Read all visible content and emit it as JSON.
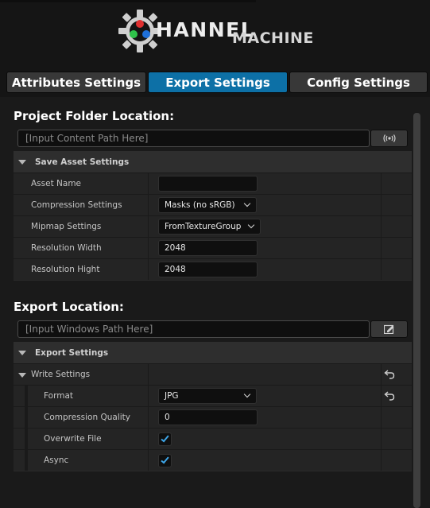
{
  "logo": {
    "first_word": "HANNEL",
    "second_word": "MACHINE",
    "icon": "gear-rgb-icon",
    "colors": {
      "red": "#e03030",
      "green": "#2fc34a",
      "blue": "#1e6fd9",
      "gear": "#cfcfcf"
    }
  },
  "tabs": [
    {
      "label": "Attributes Settings",
      "active": false
    },
    {
      "label": "Export Settings",
      "active": true
    },
    {
      "label": "Config Settings",
      "active": false
    }
  ],
  "accent_color": "#0d70a6",
  "project_folder": {
    "title": "Project Folder Location:",
    "placeholder": "[Input Content Path Here]",
    "button_icon": "broadcast-icon"
  },
  "save_asset": {
    "category_label": "Save Asset Settings",
    "rows": [
      {
        "label": "Asset Name",
        "value": ""
      },
      {
        "label": "Compression Settings",
        "value": "Masks (no sRGB)"
      },
      {
        "label": "Mipmap Settings",
        "value": "FromTextureGroup"
      },
      {
        "label": "Resolution Width",
        "value": "2048"
      },
      {
        "label": "Resolution Hight",
        "value": "2048"
      }
    ]
  },
  "export_location": {
    "title": "Export Location:",
    "placeholder": "[Input Windows Path Here]",
    "button_icon": "edit-icon"
  },
  "export_settings": {
    "category_label": "Export Settings",
    "write_settings_label": "Write Settings",
    "rows": [
      {
        "label": "Format",
        "value": "JPG"
      },
      {
        "label": "Compression Quality",
        "value": "0"
      },
      {
        "label": "Overwrite File",
        "checked": true
      },
      {
        "label": "Async",
        "checked": true
      }
    ]
  }
}
